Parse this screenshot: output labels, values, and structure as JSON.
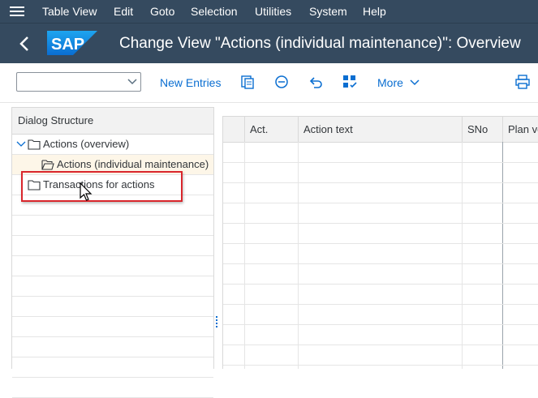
{
  "menu": {
    "items": [
      {
        "label": "Table View"
      },
      {
        "label": "Edit"
      },
      {
        "label": "Goto"
      },
      {
        "label": "Selection"
      },
      {
        "label": "Utilities"
      },
      {
        "label": "System"
      },
      {
        "label": "Help"
      }
    ]
  },
  "header": {
    "logo_text": "SAP",
    "title": "Change View \"Actions (individual maintenance)\": Overview"
  },
  "toolbar": {
    "dropdown_value": "",
    "new_entries": "New Entries",
    "more": "More"
  },
  "dialog_structure": {
    "title": "Dialog Structure",
    "items": [
      {
        "label": "Actions (overview)",
        "level": 0,
        "expanded": true
      },
      {
        "label": "Actions (individual maintenance)",
        "level": 1,
        "selected": true
      },
      {
        "label": "Transactions for actions",
        "level": 0
      }
    ]
  },
  "table": {
    "columns": [
      "",
      "Act.",
      "Action text",
      "SNo",
      "Plan ve"
    ]
  },
  "colors": {
    "shell": "#354a5f",
    "link": "#0a6ed1",
    "highlight": "#d9262c",
    "selected_row": "#fdf6e8"
  }
}
